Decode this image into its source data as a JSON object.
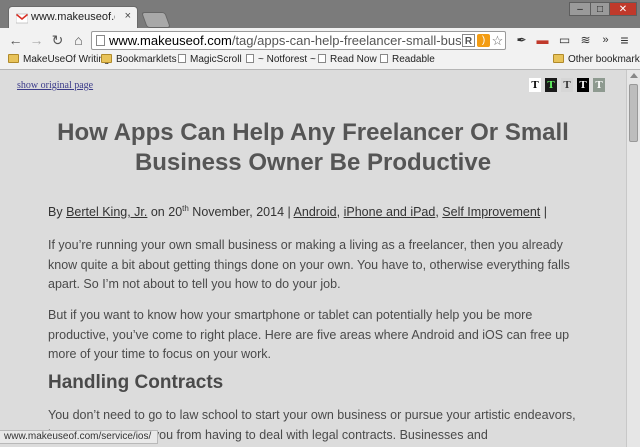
{
  "tab": {
    "title": "www.makeuseof.com/tag",
    "close": "×"
  },
  "window": {
    "minimize": "–",
    "maximize": "□",
    "close": "✕"
  },
  "toolbar": {
    "url_host": "www.makeuseof.com",
    "url_path": "/tag/apps-can-help-freelancer-small-business-own",
    "rss_label": "R",
    "overflow": "»"
  },
  "bookmarks": [
    {
      "label": "MakeUseOf Writing",
      "type": "folder"
    },
    {
      "label": "Bookmarklets",
      "type": "folder"
    },
    {
      "label": "MagicScroll",
      "type": "page"
    },
    {
      "label": "~ Notforest ~",
      "type": "page"
    },
    {
      "label": "Read Now",
      "type": "page"
    },
    {
      "label": "Readable",
      "type": "page"
    },
    {
      "label": "Other bookmarks",
      "type": "folder"
    }
  ],
  "reader": {
    "show_original": "show original page",
    "theme_buttons": [
      "T",
      "T",
      "T",
      "T",
      "T"
    ]
  },
  "article": {
    "title": "How Apps Can Help Any Freelancer Or Small Business Owner Be Productive",
    "byline": {
      "by": "By",
      "author": "Bertel King, Jr.",
      "on": "on 20",
      "sup": "th",
      "date_rest": "November, 2014 |",
      "cat1": "Android",
      "cat2": "iPhone and iPad",
      "cat3": "Self Improvement",
      "sep": "|"
    },
    "p1": "If you’re running your own small business or making a living as a freelancer, then you already know quite a bit about getting things done on your own. You have to, otherwise everything falls apart. So I’m not about to tell you how to do your job.",
    "p2": "But if you want to know how your smartphone or tablet can potentially help you be more productive, you’ve come to right place. Here are five areas where Android and iOS can free up more of your time to focus on your work.",
    "h2": "Handling Contracts",
    "p3": "You don’t need to go to law school to start your own business or pursue your artistic endeavors, but apps can save you from having to deal with legal contracts. Businesses and"
  },
  "status": {
    "url": "www.makeuseof.com/service/ios/"
  }
}
